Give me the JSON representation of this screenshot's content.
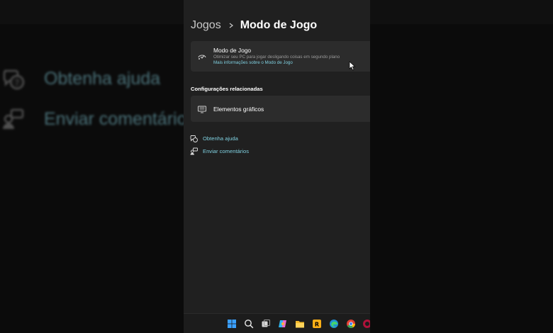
{
  "background": {
    "links": [
      {
        "label": "Obtenha ajuda",
        "icon": "help-chat-icon"
      },
      {
        "label": "Enviar comentários",
        "icon": "feedback-icon"
      }
    ]
  },
  "breadcrumb": {
    "parent": "Jogos",
    "current": "Modo de Jogo"
  },
  "game_mode_card": {
    "title": "Modo de Jogo",
    "description": "Otimizar seu PC para jogar desligando coisas em segundo plano",
    "link": "Mais informações sobre o Modo de Jogo",
    "icon": "gamepad-icon"
  },
  "related": {
    "section_title": "Configurações relacionadas",
    "graphics": {
      "title": "Elementos gráficos",
      "icon": "display-icon"
    }
  },
  "help_links": [
    {
      "label": "Obtenha ajuda",
      "icon": "help-chat-icon"
    },
    {
      "label": "Enviar comentários",
      "icon": "feedback-icon"
    }
  ],
  "taskbar": {
    "icons": [
      "windows-start-icon",
      "search-icon",
      "task-view-icon",
      "copilot-icon",
      "file-explorer-icon",
      "rockstar-launcher-icon",
      "edge-icon",
      "chrome-icon",
      "app-icon"
    ]
  },
  "colors": {
    "panel_bg": "#202020",
    "card_bg": "#2c2c2c",
    "accent_link": "#7fd0e0"
  }
}
